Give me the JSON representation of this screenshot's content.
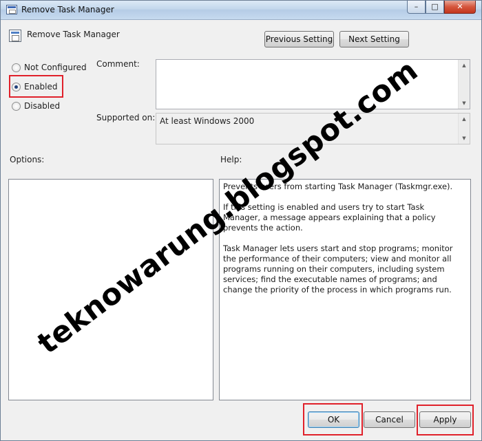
{
  "window": {
    "title": "Remove Task Manager",
    "controls": {
      "minimize": "–",
      "maximize": "□",
      "close": "✕"
    }
  },
  "header": {
    "policy_name": "Remove Task Manager",
    "policy_icon": "policy-settings-icon",
    "previous_setting_label": "Previous Setting",
    "next_setting_label": "Next Setting"
  },
  "state": {
    "options": [
      {
        "label": "Not Configured",
        "selected": false
      },
      {
        "label": "Enabled",
        "selected": true
      },
      {
        "label": "Disabled",
        "selected": false
      }
    ]
  },
  "comment": {
    "label": "Comment:",
    "value": ""
  },
  "supported_on": {
    "label": "Supported on:",
    "value": "At least Windows 2000"
  },
  "options_pane": {
    "label": "Options:"
  },
  "help_pane": {
    "label": "Help:",
    "paragraphs": [
      "Prevents users from starting Task Manager (Taskmgr.exe).",
      "If this setting is enabled and users try to start Task Manager, a message appears explaining that a policy prevents the action.",
      "Task Manager lets users start and stop programs; monitor the performance of their computers; view and monitor all programs running on their computers, including system services; find the executable names of programs; and change the priority of the process in which programs run."
    ]
  },
  "footer": {
    "ok_label": "OK",
    "cancel_label": "Cancel",
    "apply_label": "Apply"
  },
  "watermark": "teknowarung.blogspot.com",
  "colors": {
    "highlight": "#e0202a",
    "window_bg": "#f0f0f0",
    "title_gradient": "#c3d7ec"
  }
}
